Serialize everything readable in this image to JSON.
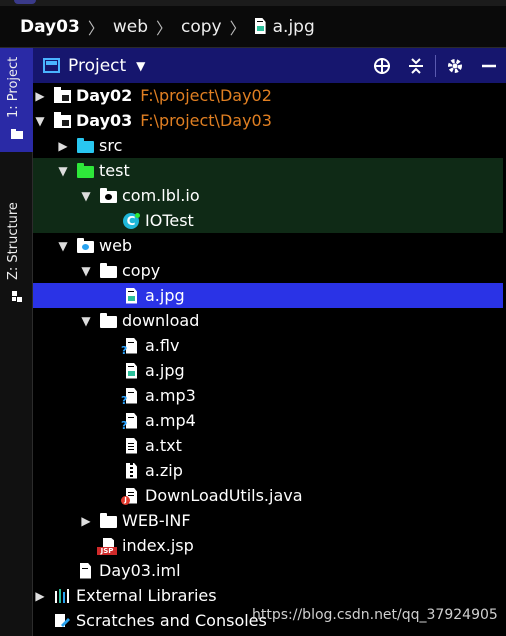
{
  "breadcrumb": {
    "items": [
      "Day03",
      "web",
      "copy",
      "a.jpg"
    ]
  },
  "sidebar": {
    "tabs": [
      {
        "label": "1: Project",
        "active": true
      },
      {
        "label": "Z: Structure",
        "active": false
      }
    ]
  },
  "toolbar": {
    "title": "Project",
    "icons": [
      "crosshair-icon",
      "collapse-icon",
      "gear-icon",
      "minimize-icon"
    ]
  },
  "tree": {
    "rows": [
      {
        "label": "Day02",
        "path": "F:\\project\\Day02",
        "icon": "project-folder-icon",
        "expanded": false
      },
      {
        "label": "Day03",
        "path": "F:\\project\\Day03",
        "icon": "project-folder-icon",
        "expanded": true
      },
      {
        "label": "src",
        "icon": "source-folder-icon",
        "expanded": false
      },
      {
        "label": "test",
        "icon": "test-folder-icon",
        "expanded": true
      },
      {
        "label": "com.lbl.io",
        "icon": "package-icon",
        "expanded": true
      },
      {
        "label": "IOTest",
        "icon": "class-icon"
      },
      {
        "label": "web",
        "icon": "web-folder-icon",
        "expanded": true
      },
      {
        "label": "copy",
        "icon": "folder-icon",
        "expanded": true
      },
      {
        "label": "a.jpg",
        "icon": "image-file-icon",
        "selected": true
      },
      {
        "label": "download",
        "icon": "folder-icon",
        "expanded": true
      },
      {
        "label": "a.flv",
        "icon": "unknown-file-icon"
      },
      {
        "label": "a.jpg",
        "icon": "image-file-icon"
      },
      {
        "label": "a.mp3",
        "icon": "unknown-file-icon"
      },
      {
        "label": "a.mp4",
        "icon": "unknown-file-icon"
      },
      {
        "label": "a.txt",
        "icon": "text-file-icon"
      },
      {
        "label": "a.zip",
        "icon": "archive-file-icon"
      },
      {
        "label": "DownLoadUtils.java",
        "icon": "java-file-icon"
      },
      {
        "label": "WEB-INF",
        "icon": "folder-icon",
        "expanded": false
      },
      {
        "label": "index.jsp",
        "icon": "jsp-file-icon"
      },
      {
        "label": "Day03.iml",
        "icon": "iml-file-icon"
      },
      {
        "label": "External Libraries",
        "icon": "libraries-icon",
        "expanded": false
      },
      {
        "label": "Scratches and Consoles",
        "icon": "scratches-icon"
      }
    ]
  },
  "watermark": "https://blog.csdn.net/qq_37924905",
  "colors": {
    "selection": "#2a33e6",
    "toolbar": "#16166e",
    "test_highlight": "#0f2a16",
    "path_text": "#e07f22"
  }
}
